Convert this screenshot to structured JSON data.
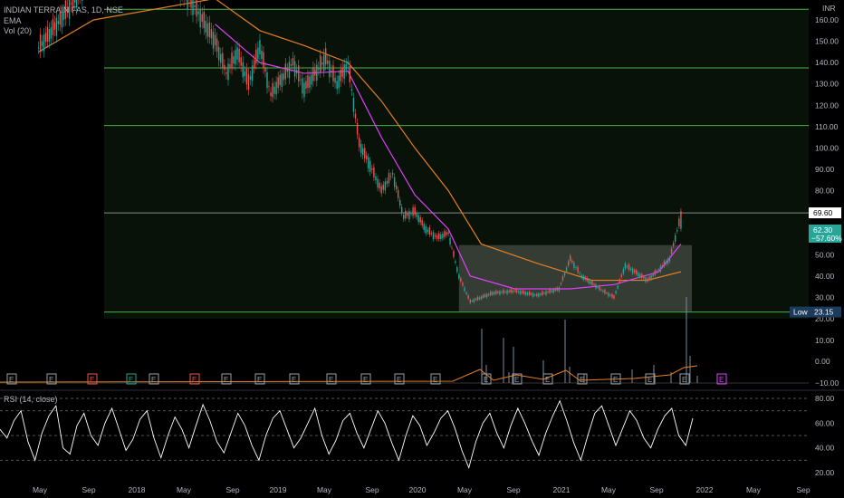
{
  "header": {
    "symbol_line": "INDIAN TERRAIN FAS, 1D, NSE",
    "ema_label": "EMA",
    "vol_label": "Vol (20)"
  },
  "currency": "INR",
  "rsi_label": "RSI (14, close)",
  "colors": {
    "background": "#000000",
    "green_line": "#4caf50",
    "candle_up": "#26a69a",
    "candle_down": "#ef5350",
    "ema_fast": "#e040fb",
    "ema_slow": "#e67e22",
    "box": "#5a5f5a",
    "rsi_line": "#ffffff",
    "last_price_bg": "#26a69a"
  },
  "chart_data": {
    "type": "line",
    "title": "INDIAN TERRAIN FAS, 1D, NSE",
    "price_axis": {
      "ticks": [
        160.0,
        150.0,
        140.0,
        130.0,
        120.0,
        110.0,
        100.0,
        90.0,
        80.0,
        70.0,
        60.0,
        50.0,
        40.0,
        30.0,
        20.0
      ],
      "unit": "INR"
    },
    "volume_axis_ticks": [
      "10.00",
      "0.00",
      "−10.00"
    ],
    "x_ticks": [
      "May",
      "Sep",
      "2018",
      "May",
      "Sep",
      "2019",
      "May",
      "Sep",
      "2020",
      "May",
      "Sep",
      "2021",
      "May",
      "Sep",
      "2022",
      "May",
      "Sep"
    ],
    "horizontal_levels": [
      165.0,
      137.5,
      110.5,
      69.6,
      23.15
    ],
    "consolidation_box": {
      "low": 23.5,
      "high": 54.5,
      "start": "2020-03",
      "end": "2021-12"
    },
    "price_series": {
      "name": "Price",
      "dates": [
        "2017-01",
        "2017-03",
        "2017-05",
        "2017-07",
        "2017-09",
        "2017-11",
        "2018-01",
        "2018-03",
        "2018-05",
        "2018-06",
        "2018-07",
        "2018-08",
        "2018-09",
        "2018-10",
        "2018-12",
        "2019-01",
        "2019-03",
        "2019-04",
        "2019-05",
        "2019-06",
        "2019-07",
        "2019-08",
        "2019-09",
        "2019-10",
        "2019-11",
        "2019-12",
        "2020-01",
        "2020-02",
        "2020-03",
        "2020-04",
        "2020-06",
        "2020-08",
        "2020-10",
        "2020-12",
        "2021-01",
        "2021-02",
        "2021-04",
        "2021-05",
        "2021-06",
        "2021-08",
        "2021-09",
        "2021-10",
        "2021-11",
        "2021-11b"
      ],
      "values": [
        147,
        160,
        175,
        185,
        190,
        188,
        180,
        168,
        150,
        135,
        145,
        130,
        148,
        125,
        140,
        128,
        142,
        130,
        140,
        102,
        92,
        80,
        88,
        68,
        70,
        62,
        58,
        60,
        40,
        28,
        32,
        33,
        31,
        34,
        48,
        40,
        33,
        30,
        45,
        38,
        43,
        48,
        68,
        62.3
      ]
    },
    "ema_fast": {
      "name": "EMA",
      "dates": [
        "2018-05",
        "2018-09",
        "2019-01",
        "2019-05",
        "2019-08",
        "2019-11",
        "2020-02",
        "2020-04",
        "2020-08",
        "2021-01",
        "2021-05",
        "2021-09",
        "2021-11"
      ],
      "values": [
        158,
        140,
        135,
        136,
        105,
        78,
        62,
        40,
        34,
        34,
        36,
        42,
        55
      ]
    },
    "ema_slow": {
      "name": "EMA",
      "dates": [
        "2017-01",
        "2017-06",
        "2018-05",
        "2018-09",
        "2019-01",
        "2019-05",
        "2019-08",
        "2019-11",
        "2020-02",
        "2020-05",
        "2020-10",
        "2021-03",
        "2021-08",
        "2021-11"
      ],
      "values": [
        145,
        160,
        170,
        155,
        148,
        140,
        122,
        100,
        80,
        55,
        46,
        38,
        38,
        42
      ]
    },
    "last_price": "62.30",
    "last_change": "−57.60%",
    "high_level_label": "69.60",
    "low_label": "Low",
    "low_value": "23.15",
    "earnings_markers": [
      "E",
      "E",
      "E",
      "E",
      "E",
      "E",
      "E",
      "E",
      "E",
      "E",
      "E",
      "E",
      "E",
      "E",
      "E",
      "E",
      "E",
      "E",
      "E",
      "E",
      "E"
    ],
    "rsi": {
      "ticks": [
        "80.00",
        "60.00",
        "40.00",
        "20.00"
      ],
      "levels": [
        80,
        70,
        50,
        30
      ],
      "values": [
        55,
        48,
        62,
        70,
        45,
        30,
        52,
        66,
        74,
        40,
        35,
        58,
        68,
        50,
        42,
        60,
        72,
        55,
        38,
        47,
        63,
        70,
        48,
        32,
        50,
        65,
        55,
        40,
        58,
        75,
        62,
        45,
        36,
        52,
        68,
        58,
        42,
        30,
        50,
        64,
        70,
        55,
        40,
        48,
        60,
        72,
        50,
        35,
        46,
        62,
        68,
        52,
        40,
        55,
        70,
        60,
        44,
        30,
        50,
        66,
        58,
        42,
        52,
        64,
        70,
        56,
        38,
        24,
        45,
        60,
        68,
        52,
        40,
        58,
        72,
        60,
        46,
        34,
        52,
        66,
        78,
        62,
        44,
        30,
        50,
        68,
        74,
        58,
        42,
        56,
        70,
        62,
        48,
        40,
        55,
        66,
        72,
        50,
        42,
        64
      ]
    }
  }
}
